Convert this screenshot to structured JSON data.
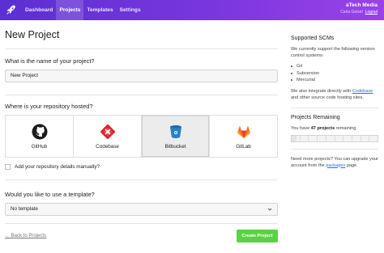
{
  "nav": {
    "items": [
      {
        "label": "Dashboard",
        "active": false
      },
      {
        "label": "Projects",
        "active": true
      },
      {
        "label": "Templates",
        "active": false
      },
      {
        "label": "Settings",
        "active": false
      }
    ]
  },
  "account": {
    "name": "aTech Media",
    "user": "Carla Geisel",
    "logout": "Logout"
  },
  "page": {
    "title": "New Project"
  },
  "form": {
    "name_question": "What is the name of your project?",
    "name_value": "New Project",
    "repo_question": "Where is your repository hosted?",
    "scms": [
      {
        "label": "GitHub",
        "icon": "github-icon",
        "selected": false
      },
      {
        "label": "Codebase",
        "icon": "codebase-icon",
        "selected": false
      },
      {
        "label": "Bitbucket",
        "icon": "bitbucket-icon",
        "selected": true
      },
      {
        "label": "GitLab",
        "icon": "gitlab-icon",
        "selected": false
      }
    ],
    "manual_label": "Add your repository details manually?",
    "template_question": "Would you like to use a template?",
    "template_value": "No template",
    "back_link": "← Back to Projects",
    "create_button": "Create Project"
  },
  "sidebar": {
    "scm_title": "Supported SCMs",
    "scm_intro": "We currently support the following version control systems:",
    "scm_list": [
      "Git",
      "Subversion",
      "Mercurial"
    ],
    "integrate_before": "We also integrate directly with ",
    "integrate_link": "Codebase",
    "integrate_after": " and other source code hosting sites.",
    "remaining_title": "Projects Remaining",
    "remaining_before": "You have ",
    "remaining_count": "47 projects",
    "remaining_after": " remaining.",
    "remaining_fraction": 0.06,
    "upgrade_before": "Need more projects? You can upgrade your account from the ",
    "upgrade_link": "packages",
    "upgrade_after": " page."
  },
  "colors": {
    "brand_gradient_start": "#5b2fd3",
    "brand_gradient_end": "#9b42e8",
    "create_button": "#5cd146",
    "link": "#2f6fd6"
  }
}
